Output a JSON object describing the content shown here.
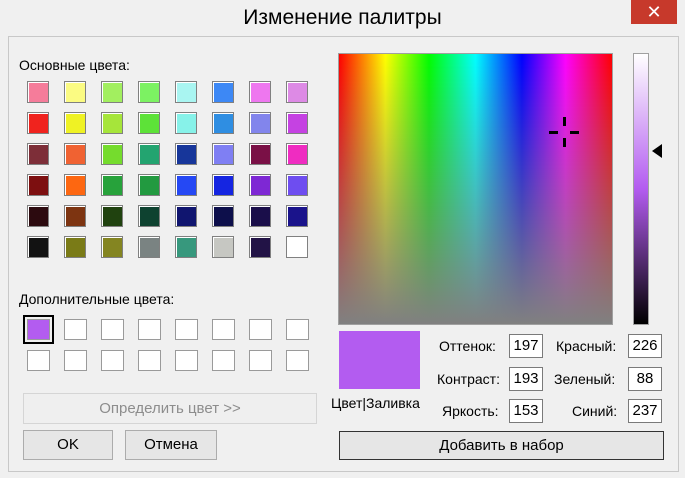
{
  "window": {
    "title": "Изменение палитры",
    "close_glyph": "✕"
  },
  "basic": {
    "label": "Основные цвета:",
    "colors": [
      [
        "#f57c9a",
        "#fbfb82",
        "#a2ef5f",
        "#7cf262",
        "#a9f5f1",
        "#3d88f5",
        "#ee77ef",
        "#dd8ae5"
      ],
      [
        "#f0231e",
        "#eff224",
        "#a6e53a",
        "#5de238",
        "#87f2e9",
        "#2f8ee2",
        "#8285ec",
        "#c542e2"
      ],
      [
        "#7d2e38",
        "#f06232",
        "#75dc2d",
        "#23a470",
        "#17369a",
        "#7f7ff3",
        "#7a1046",
        "#ef2cc1"
      ],
      [
        "#7d0f10",
        "#fd6711",
        "#27a23b",
        "#229a40",
        "#2548f4",
        "#1525e1",
        "#7e28d4",
        "#6e4df0"
      ],
      [
        "#2c0a0f",
        "#7d3411",
        "#20420f",
        "#0e4230",
        "#10156f",
        "#0d0f4b",
        "#1a0e4a",
        "#1a138b"
      ],
      [
        "#121212",
        "#7a7b17",
        "#848521",
        "#7a8382",
        "#37987d",
        "#c6c7c2",
        "#221346",
        "#ffffff"
      ]
    ]
  },
  "custom": {
    "label": "Дополнительные цвета:"
  },
  "buttons": {
    "define": "Определить цвет >>",
    "ok": "OK",
    "cancel": "Отмена",
    "add": "Добавить в набор"
  },
  "preview": {
    "label": "Цвет|Заливка"
  },
  "hsl": {
    "hue_label": "Оттенок:",
    "hue": "197",
    "sat_label": "Контраст:",
    "sat": "193",
    "lum_label": "Яркость:",
    "lum": "153"
  },
  "rgb": {
    "red_label": "Красный:",
    "red": "226",
    "green_label": "Зеленый:",
    "green": "88",
    "blue_label": "Синий:",
    "blue": "237"
  }
}
